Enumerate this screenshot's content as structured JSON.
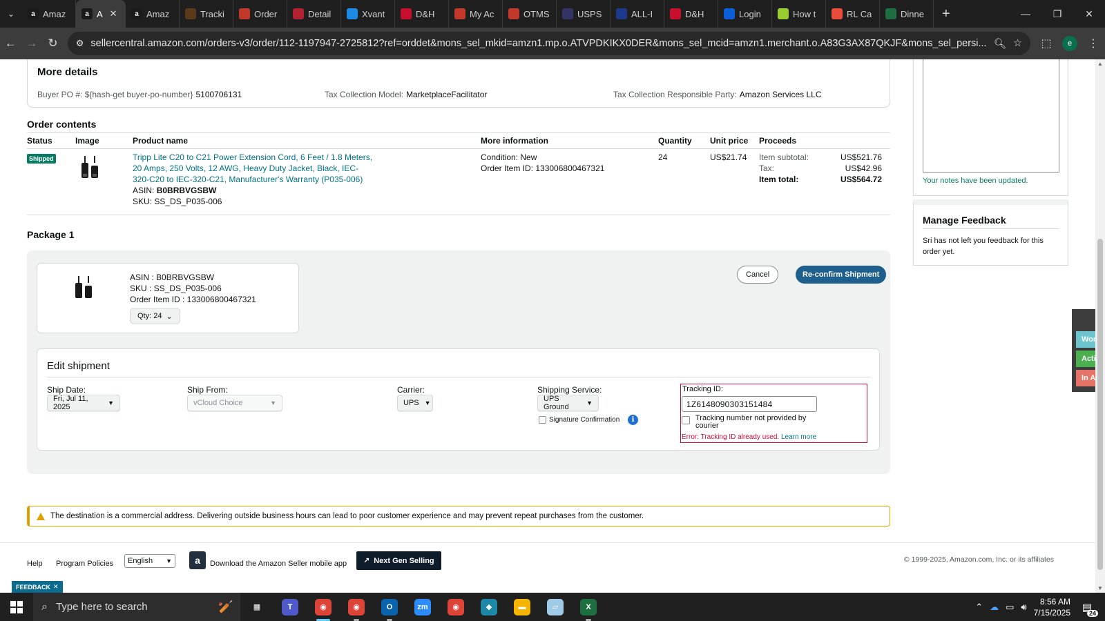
{
  "browser": {
    "tabs": [
      {
        "label": "Amaz",
        "favicon": "amazon",
        "color": "#1a1a1a"
      },
      {
        "label": "A",
        "favicon": "amazon",
        "color": "#1a1a1a",
        "active": true
      },
      {
        "label": "Amaz",
        "favicon": "amazon",
        "color": "#1a1a1a"
      },
      {
        "label": "Tracki",
        "favicon": "ups",
        "color": "#5a3a1a"
      },
      {
        "label": "Order",
        "favicon": "order",
        "color": "#c0392b"
      },
      {
        "label": "Detail",
        "favicon": "flag",
        "color": "#b22234"
      },
      {
        "label": "Xvant",
        "favicon": "xvant",
        "color": "#1e88e5"
      },
      {
        "label": "D&H",
        "favicon": "dh",
        "color": "#c8102e"
      },
      {
        "label": "My Ac",
        "favicon": "myac",
        "color": "#c0392b"
      },
      {
        "label": "OTMS",
        "favicon": "otms",
        "color": "#c0392b"
      },
      {
        "label": "USPS",
        "favicon": "usps",
        "color": "#333366"
      },
      {
        "label": "ALL-I",
        "favicon": "17track",
        "color": "#1e3a8a"
      },
      {
        "label": "D&H",
        "favicon": "dh",
        "color": "#c8102e"
      },
      {
        "label": "Login",
        "favicon": "ec",
        "color": "#0b5ed7"
      },
      {
        "label": "How t",
        "favicon": "howto",
        "color": "#9acd32"
      },
      {
        "label": "RL Ca",
        "favicon": "rl",
        "color": "#e74c3c"
      },
      {
        "label": "Dinne",
        "favicon": "excel",
        "color": "#1d6f42"
      }
    ],
    "url": "sellercentral.amazon.com/orders-v3/order/112-1197947-2725812?ref=orddet&mons_sel_mkid=amzn1.mp.o.ATVPDKIKX0DER&mons_sel_mcid=amzn1.merchant.o.A83G3AX87QKJF&mons_sel_persi...",
    "profile_initial": "e"
  },
  "more_details": {
    "title": "More details",
    "buyer_po_label": "Buyer PO #: ${hash-get buyer-po-number}",
    "buyer_po_value": "5100706131",
    "tax_model_label": "Tax Collection Model:",
    "tax_model_value": "MarketplaceFacilitator",
    "tax_party_label": "Tax Collection Responsible Party:",
    "tax_party_value": "Amazon Services LLC"
  },
  "order_contents": {
    "title": "Order contents",
    "headers": [
      "Status",
      "Image",
      "Product name",
      "More information",
      "Quantity",
      "Unit price",
      "Proceeds"
    ],
    "row": {
      "status": "Shipped",
      "product_name": "Tripp Lite C20 to C21 Power Extension Cord, 6 Feet / 1.8 Meters, 20 Amps, 250 Volts, 12 AWG, Heavy Duty Jacket, Black, IEC-320-C20 to IEC-320-C21, Manufacturer's Warranty (P035-006)",
      "asin_label": "ASIN:",
      "asin": "B0BRBVGSBW",
      "sku_label": "SKU:",
      "sku": "SS_DS_P035-006",
      "condition": "Condition: New",
      "order_item_id": "Order Item ID: 133006800467321",
      "quantity": "24",
      "unit_price": "US$21.74",
      "item_subtotal_label": "Item subtotal:",
      "item_subtotal": "US$521.76",
      "tax_label": "Tax:",
      "tax": "US$42.96",
      "item_total_label": "Item total:",
      "item_total": "US$564.72"
    }
  },
  "package": {
    "title": "Package 1",
    "asin_line": "ASIN : B0BRBVGSBW",
    "sku_line": "SKU : SS_DS_P035-006",
    "order_item_line": "Order Item ID : 133006800467321",
    "qty_label": "Qty: 24"
  },
  "edit_shipment": {
    "title": "Edit shipment",
    "ship_date_label": "Ship Date:",
    "ship_date_value": "Fri, Jul 11, 2025",
    "ship_from_label": "Ship From:",
    "ship_from_value": "vCloud Choice",
    "carrier_label": "Carrier:",
    "carrier_value": "UPS",
    "service_label": "Shipping Service:",
    "service_value": "UPS Ground",
    "signature_label": "Signature Confirmation",
    "tracking_label": "Tracking ID:",
    "tracking_value": "1Z6148090303151484",
    "not_provided_label": "Tracking number not provided by courier",
    "error_text": "Error: Tracking ID already used.",
    "learn_more": "Learn more",
    "cancel_label": "Cancel",
    "confirm_label": "Re-confirm Shipment"
  },
  "warning": {
    "text": "The destination is a commercial address. Delivering outside business hours can lead to poor customer experience and may prevent repeat purchases from the customer."
  },
  "notes": {
    "updated_text": "Your notes have been updated."
  },
  "feedback": {
    "title": "Manage Feedback",
    "text": "Sri has not left you feedback for this order yet."
  },
  "side_widget": [
    {
      "label": "Worki",
      "color": "#6cc4cf"
    },
    {
      "label": "Active",
      "color": "#4caf50"
    },
    {
      "label": "In Act",
      "color": "#e57368"
    }
  ],
  "footer": {
    "help": "Help",
    "program_policies": "Program Policies",
    "language": "English",
    "download_app": "Download the Amazon Seller mobile app",
    "next_gen": "Next Gen Selling",
    "copyright": "© 1999-2025, Amazon.com, Inc. or its affiliates",
    "feedback_tab": "FEEDBACK"
  },
  "taskbar": {
    "search_placeholder": "Type here to search",
    "apps": [
      {
        "name": "task-view",
        "color": "#202020",
        "glyph": "▦"
      },
      {
        "name": "teams",
        "color": "#5059c9",
        "glyph": "T"
      },
      {
        "name": "chrome",
        "color": "#db4437",
        "glyph": "◉",
        "active": true
      },
      {
        "name": "chrome-profile",
        "color": "#db4437",
        "glyph": "◉",
        "running": true
      },
      {
        "name": "outlook",
        "color": "#0a64ad",
        "glyph": "O",
        "running": true
      },
      {
        "name": "zoom",
        "color": "#2d8cff",
        "glyph": "zm"
      },
      {
        "name": "chrome-2",
        "color": "#db4437",
        "glyph": "◉"
      },
      {
        "name": "app-diamond",
        "color": "#1e88a8",
        "glyph": "◆"
      },
      {
        "name": "file-explorer",
        "color": "#f4b400",
        "glyph": "▬"
      },
      {
        "name": "notepad",
        "color": "#9ecbe6",
        "glyph": "▱"
      },
      {
        "name": "excel",
        "color": "#1d6f42",
        "glyph": "X",
        "running": true
      }
    ],
    "time": "8:56 AM",
    "date": "7/15/2025",
    "notification_count": "24"
  }
}
